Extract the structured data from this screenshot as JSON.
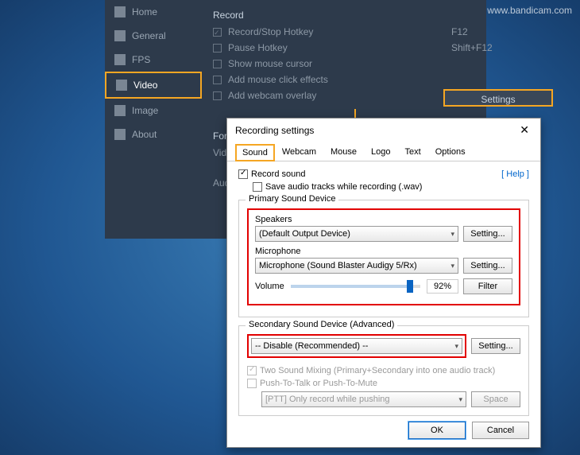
{
  "watermark": "www.bandicam.com",
  "sidebar": {
    "items": [
      {
        "label": "Home"
      },
      {
        "label": "General"
      },
      {
        "label": "FPS"
      },
      {
        "label": "Video"
      },
      {
        "label": "Image"
      },
      {
        "label": "About"
      }
    ]
  },
  "record": {
    "section": "Record",
    "hotkey_label": "Record/Stop Hotkey",
    "hotkey_value": "F12",
    "pause_label": "Pause Hotkey",
    "pause_value": "Shift+F12",
    "cursor_label": "Show mouse cursor",
    "click_label": "Add mouse click effects",
    "webcam_label": "Add webcam overlay",
    "settings_btn": "Settings",
    "format_section": "Format",
    "video_label": "Video",
    "audio_label": "Audio"
  },
  "dialog": {
    "title": "Recording settings",
    "tabs": [
      "Sound",
      "Webcam",
      "Mouse",
      "Logo",
      "Text",
      "Options"
    ],
    "record_sound": "Record sound",
    "save_wav": "Save audio tracks while recording (.wav)",
    "help": "[ Help ]",
    "primary": {
      "title": "Primary Sound Device",
      "speakers_label": "Speakers",
      "speakers_value": "(Default Output Device)",
      "mic_label": "Microphone",
      "mic_value": "Microphone (Sound Blaster Audigy 5/Rx)",
      "volume_label": "Volume",
      "volume_value": "92%",
      "setting_btn": "Setting...",
      "filter_btn": "Filter"
    },
    "secondary": {
      "title": "Secondary Sound Device (Advanced)",
      "value": "-- Disable (Recommended) --",
      "setting_btn": "Setting...",
      "mix_label": "Two Sound Mixing (Primary+Secondary into one audio track)",
      "ptt_label": "Push-To-Talk or Push-To-Mute",
      "ptt_mode": "[PTT] Only record while pushing",
      "ptt_key": "Space"
    },
    "ok": "OK",
    "cancel": "Cancel"
  }
}
